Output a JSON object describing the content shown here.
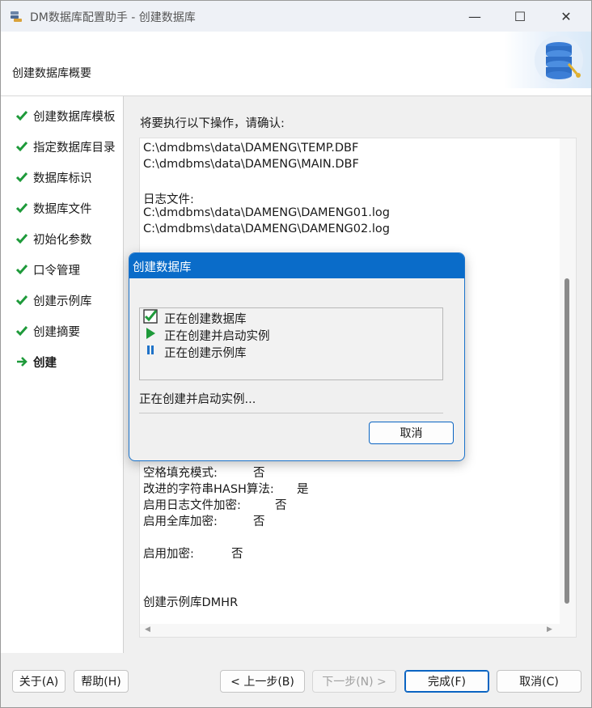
{
  "window": {
    "title": "DM数据库配置助手 - 创建数据库",
    "controls": {
      "minimize": "—",
      "maximize": "☐",
      "close": "✕"
    }
  },
  "header": {
    "title": "创建数据库概要",
    "image_icon": "database-icon"
  },
  "sidebar": {
    "items": [
      {
        "label": "创建数据库模板",
        "state": "done"
      },
      {
        "label": "指定数据库目录",
        "state": "done"
      },
      {
        "label": "数据库标识",
        "state": "done"
      },
      {
        "label": "数据库文件",
        "state": "done"
      },
      {
        "label": "初始化参数",
        "state": "done"
      },
      {
        "label": "口令管理",
        "state": "done"
      },
      {
        "label": "创建示例库",
        "state": "done"
      },
      {
        "label": "创建摘要",
        "state": "done"
      },
      {
        "label": "创建",
        "state": "current"
      }
    ]
  },
  "main": {
    "prompt": "将要执行以下操作，请确认:",
    "log_lines": {
      "l1": "C:\\dmdbms\\data\\DAMENG\\TEMP.DBF",
      "l2": "C:\\dmdbms\\data\\DAMENG\\MAIN.DBF",
      "l3": "日志文件:",
      "l4": "C:\\dmdbms\\data\\DAMENG\\DAMENG01.log",
      "l5": "C:\\dmdbms\\data\\DAMENG\\DAMENG02.log",
      "l6_label": "空格填充模式:",
      "l6_value": "否",
      "l7_label": "改进的字符串HASH算法:",
      "l7_value": "是",
      "l8_label": "启用日志文件加密:",
      "l8_value": "否",
      "l9_label": "启用全库加密:",
      "l9_value": "否",
      "l10_label": "启用加密:",
      "l10_value": "否",
      "l11": "创建示例库DMHR"
    }
  },
  "footer": {
    "about": "关于(A)",
    "help": "帮助(H)",
    "prev": "< 上一步(B)",
    "next": "下一步(N) >",
    "finish": "完成(F)",
    "cancel": "取消(C)"
  },
  "dialog": {
    "title": "创建数据库",
    "tasks": [
      {
        "label": "正在创建数据库",
        "icon": "checked-box-icon"
      },
      {
        "label": "正在创建并启动实例",
        "icon": "play-icon"
      },
      {
        "label": "正在创建示例库",
        "icon": "pause-icon"
      }
    ],
    "status": "正在创建并启动实例...",
    "cancel": "取消"
  },
  "colors": {
    "accent": "#0a6cc9",
    "check_green": "#1e9a3a"
  }
}
